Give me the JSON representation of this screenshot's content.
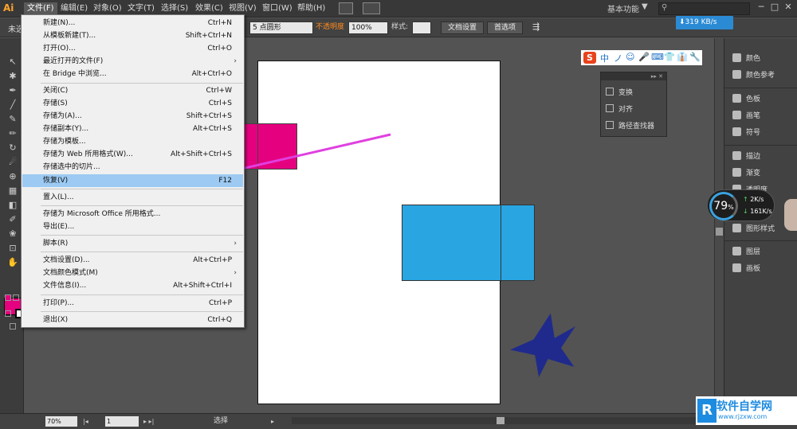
{
  "menubar": {
    "logo": "Ai",
    "items": [
      "文件(F)",
      "编辑(E)",
      "对象(O)",
      "文字(T)",
      "选择(S)",
      "效果(C)",
      "视图(V)",
      "窗口(W)",
      "帮助(H)"
    ],
    "workspace": "基本功能",
    "workspace_arrow": "▼",
    "window_buttons": [
      "─",
      "□",
      "✕"
    ]
  },
  "netspeed": "⬇319 KB/s",
  "controlbar": {
    "unselected": "未选",
    "stroke_profile": "5 点圆形",
    "opacity_label": "不透明度",
    "opacity_value": "100%",
    "style_label": "样式:",
    "doc_setup": "文档设置",
    "preferences": "首选项"
  },
  "file_menu": {
    "items": [
      {
        "label": "新建(N)...",
        "shortcut": "Ctrl+N"
      },
      {
        "label": "从模板新建(T)...",
        "shortcut": "Shift+Ctrl+N"
      },
      {
        "label": "打开(O)...",
        "shortcut": "Ctrl+O"
      },
      {
        "label": "最近打开的文件(F)",
        "shortcut": "",
        "submenu": "›"
      },
      {
        "label": "在 Bridge 中浏览...",
        "shortcut": "Alt+Ctrl+O"
      },
      {
        "label": "关闭(C)",
        "shortcut": "Ctrl+W"
      },
      {
        "label": "存储(S)",
        "shortcut": "Ctrl+S"
      },
      {
        "label": "存储为(A)...",
        "shortcut": "Shift+Ctrl+S"
      },
      {
        "label": "存储副本(Y)...",
        "shortcut": "Alt+Ctrl+S"
      },
      {
        "label": "存储为模板...",
        "shortcut": ""
      },
      {
        "label": "存储为 Web 所用格式(W)...",
        "shortcut": "Alt+Shift+Ctrl+S"
      },
      {
        "label": "存储选中的切片...",
        "shortcut": ""
      },
      {
        "label": "恢复(V)",
        "shortcut": "F12"
      },
      {
        "label": "置入(L)...",
        "shortcut": ""
      },
      {
        "label": "存储为 Microsoft Office 所用格式...",
        "shortcut": ""
      },
      {
        "label": "导出(E)...",
        "shortcut": ""
      },
      {
        "label": "脚本(R)",
        "shortcut": "",
        "submenu": "›"
      },
      {
        "label": "文档设置(D)...",
        "shortcut": "Alt+Ctrl+P"
      },
      {
        "label": "文档颜色模式(M)",
        "shortcut": "",
        "submenu": "›"
      },
      {
        "label": "文件信息(I)...",
        "shortcut": "Alt+Shift+Ctrl+I"
      },
      {
        "label": "打印(P)...",
        "shortcut": "Ctrl+P"
      },
      {
        "label": "退出(X)",
        "shortcut": "Ctrl+Q"
      }
    ]
  },
  "sogou": [
    "S",
    "中",
    "ノ",
    "☺",
    "🎤",
    "⌨",
    "👕",
    "👔",
    "🔧"
  ],
  "float_panel": {
    "collapse": "▸▸ ✕",
    "items": [
      "变换",
      "对齐",
      "路径查找器"
    ]
  },
  "dock": {
    "items": [
      "颜色",
      "颜色参考",
      "色板",
      "画笔",
      "符号",
      "描边",
      "渐变",
      "透明度",
      "图形样式",
      "图层",
      "画板"
    ]
  },
  "gauge": {
    "percent": "79",
    "unit": "%",
    "up_speed": "2K/s",
    "down_speed": "161K/s"
  },
  "statusbar": {
    "zoom": "70%",
    "page": "1",
    "tool": "选择"
  },
  "watermark": {
    "mark": "R",
    "name": "软件自学网",
    "url": "www.rjzxw.com"
  },
  "colors": {
    "fill": "#e5007f",
    "pink_rect": "#e5007f",
    "blue_rect": "#29a6e2",
    "star": "#1f2a8c",
    "arrow": "#e040e0",
    "menu_highlight": "#9ccaf2"
  }
}
